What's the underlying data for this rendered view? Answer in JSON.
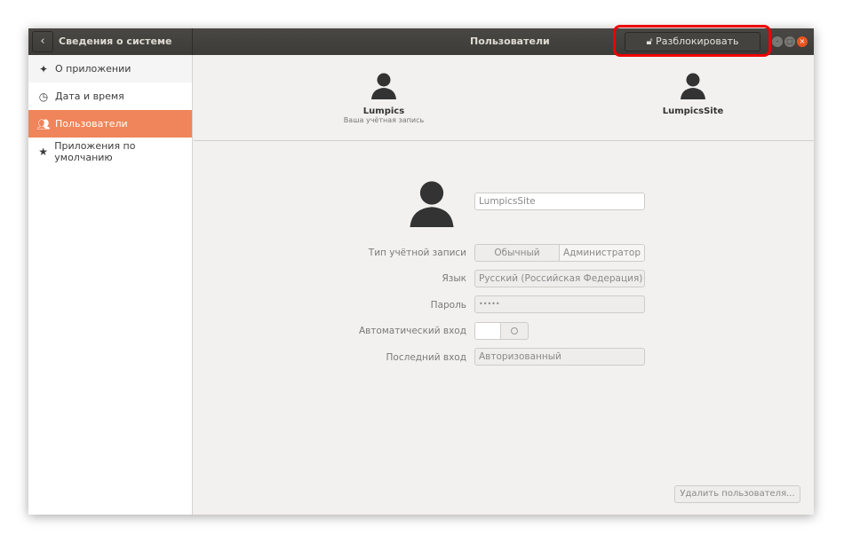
{
  "titlebar": {
    "section_title": "Сведения о системе",
    "page_title": "Пользователи",
    "unlock_label": "Разблокировать"
  },
  "sidebar": {
    "items": [
      {
        "label": "О приложении",
        "icon": "sparkle-icon"
      },
      {
        "label": "Дата и время",
        "icon": "clock-icon"
      },
      {
        "label": "Пользователи",
        "icon": "users-icon"
      },
      {
        "label": "Приложения по умолчанию",
        "icon": "star-icon"
      }
    ]
  },
  "users": [
    {
      "name": "Lumpics",
      "subtitle": "Ваша учётная запись"
    },
    {
      "name": "LumpicsSite"
    }
  ],
  "details": {
    "username": "LumpicsSite",
    "account_type_label": "Тип учётной записи",
    "account_type_options": [
      "Обычный",
      "Администратор"
    ],
    "language_label": "Язык",
    "language": "Русский (Российская Федерация)",
    "password_label": "Пароль",
    "password": "•••••",
    "autologin_label": "Автоматический вход",
    "last_login_label": "Последний вход",
    "last_login": "Авторизованный"
  },
  "delete_label": "Удалить пользователя..."
}
